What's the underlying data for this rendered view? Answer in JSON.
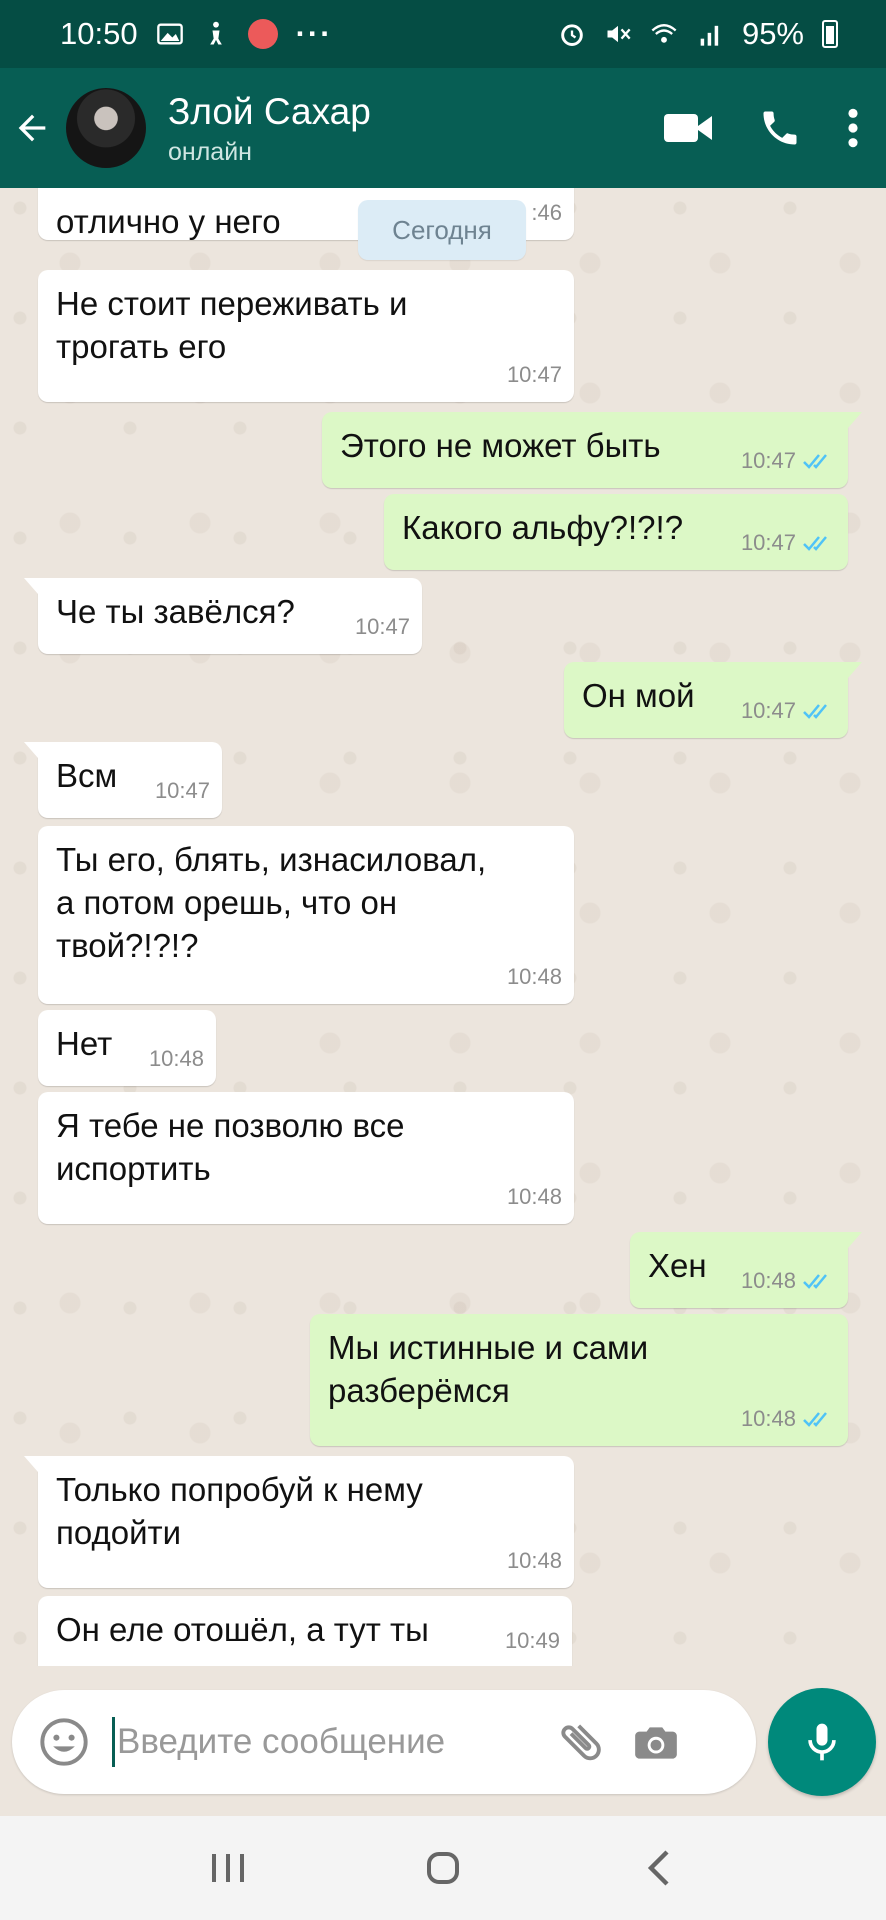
{
  "status_bar": {
    "time": "10:50",
    "battery": "95%",
    "extra_dots": "···",
    "record_color": "#ec5a5a"
  },
  "header": {
    "contact_name": "Злой Сахар",
    "contact_status": "онлайн",
    "back_icon": "arrow-left-icon",
    "video_icon": "video-camera-icon",
    "call_icon": "phone-icon",
    "menu_icon": "more-vert-icon"
  },
  "chat": {
    "date_chip": "Сегодня",
    "messages": [
      {
        "dir": "in",
        "text": "отлично у него",
        "time": ":46"
      },
      {
        "dir": "in",
        "text": "Не стоит переживать и\nтрогать его",
        "time": "10:47"
      },
      {
        "dir": "out",
        "text": "Этого не может быть",
        "time": "10:47"
      },
      {
        "dir": "out",
        "text": "Какого альфу?!?!?",
        "time": "10:47"
      },
      {
        "dir": "in",
        "text": "Че ты завёлся?",
        "time": "10:47"
      },
      {
        "dir": "out",
        "text": "Он мой",
        "time": "10:47"
      },
      {
        "dir": "in",
        "text": "Всм",
        "time": "10:47"
      },
      {
        "dir": "in",
        "text": "Ты его, блять, изнасиловал,\nа потом орешь, что он\nтвой?!?!?",
        "time": "10:48"
      },
      {
        "dir": "in",
        "text": "Нет",
        "time": "10:48"
      },
      {
        "dir": "in",
        "text": "Я тебе не позволю все\nиспортить",
        "time": "10:48"
      },
      {
        "dir": "out",
        "text": "Хен",
        "time": "10:48"
      },
      {
        "dir": "out",
        "text": "Мы истинные и сами\nразберёмся",
        "time": "10:48"
      },
      {
        "dir": "in",
        "text": "Только попробуй к нему\nподойти",
        "time": "10:48"
      },
      {
        "dir": "in",
        "text": "Он еле отошёл, а тут ты",
        "time": "10:49"
      }
    ]
  },
  "composer": {
    "placeholder": "Введите сообщение",
    "emoji_icon": "emoji-icon",
    "attach_icon": "paperclip-icon",
    "camera_icon": "camera-icon",
    "mic_icon": "microphone-icon",
    "accent": "#00897b"
  },
  "colors": {
    "header": "#075e54",
    "statusbar": "#054d44",
    "outgoing_bubble": "#dcf8c6",
    "incoming_bubble": "#ffffff",
    "read_ticks": "#4fc3f7"
  }
}
